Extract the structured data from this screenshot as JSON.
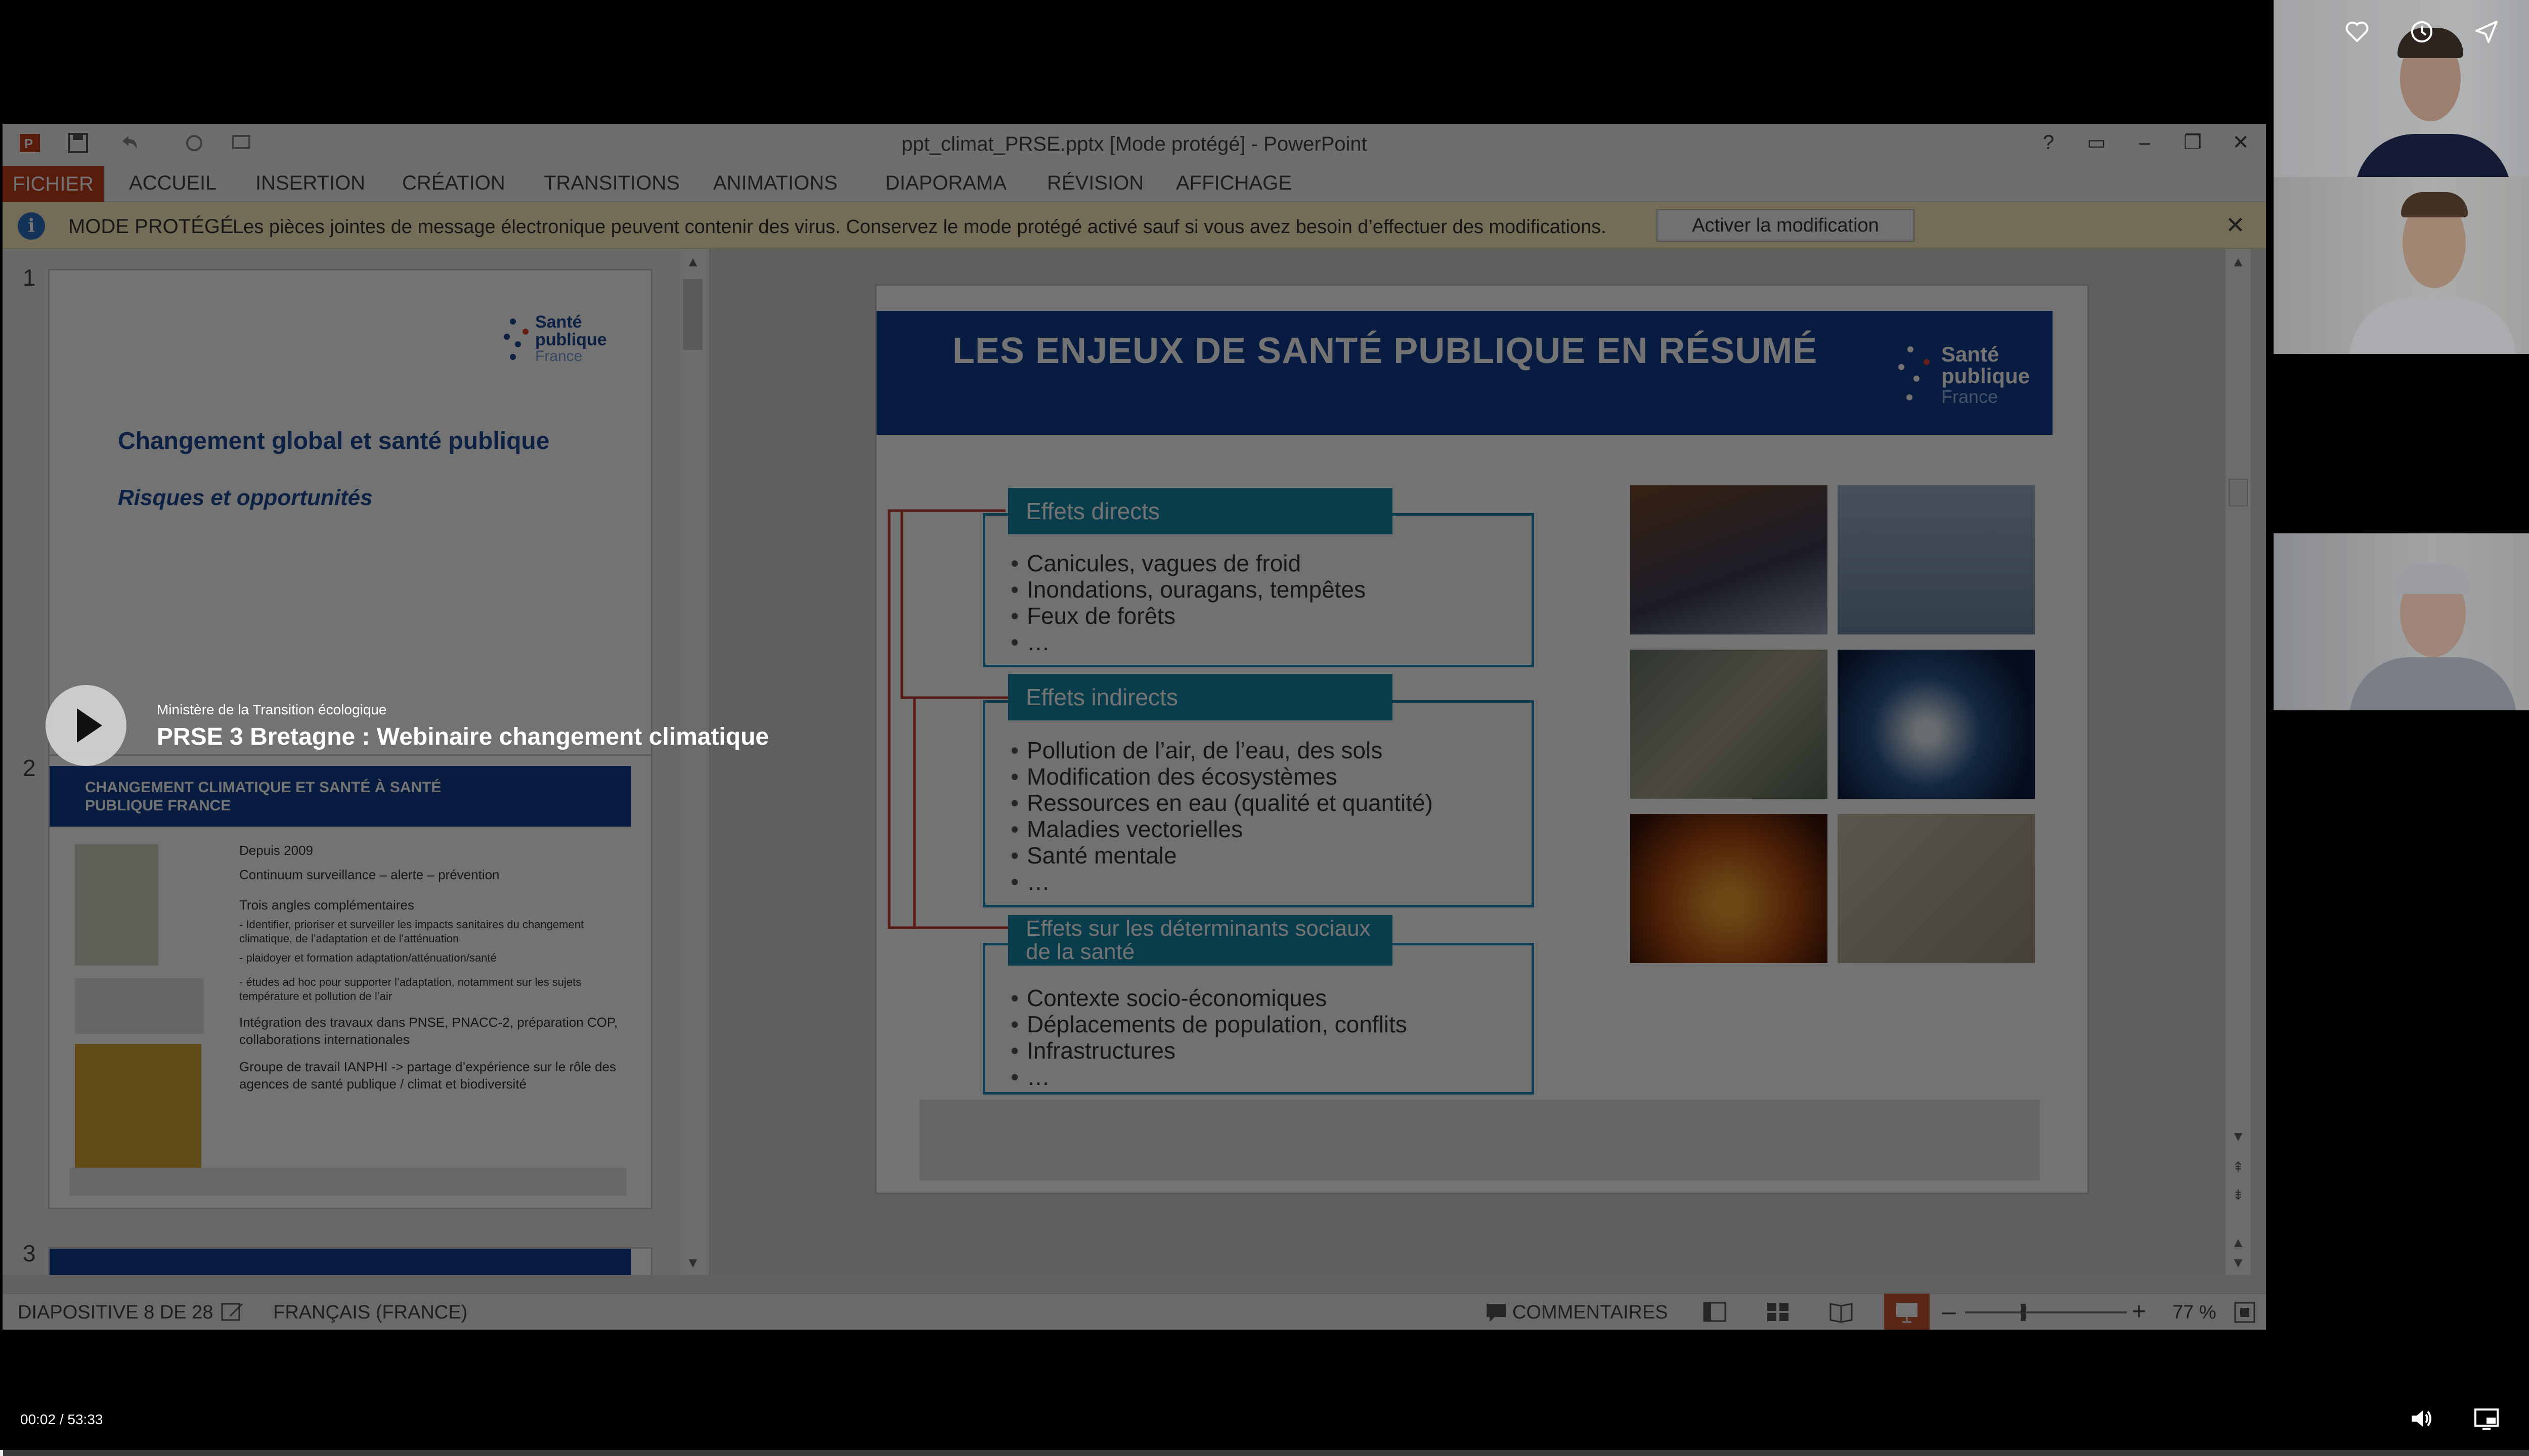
{
  "video": {
    "channel": "Ministère de la Transition écologique",
    "title": "PRSE 3 Bretagne : Webinaire changement climatique",
    "time_current": "00:02",
    "time_total": "53:33",
    "time_display": "00:02 / 53:33",
    "progress_fraction": 0.0006
  },
  "ppt": {
    "window_title": "ppt_climat_PRSE.pptx [Mode protégé] - PowerPoint",
    "tabs": [
      "FICHIER",
      "ACCUEIL",
      "INSERTION",
      "CRÉATION",
      "TRANSITIONS",
      "ANIMATIONS",
      "DIAPORAMA",
      "RÉVISION",
      "AFFICHAGE"
    ],
    "protected": {
      "title": "MODE PROTÉGÉ",
      "message": "Les pièces jointes de message électronique peuvent contenir des virus. Conservez le mode protégé activé sauf si vous avez besoin d’effectuer des modifications.",
      "button": "Activer la modification"
    },
    "status": {
      "slide": "DIAPOSITIVE 8 DE 28",
      "language": "FRANÇAIS (FRANCE)",
      "comments": "COMMENTAIRES",
      "zoom": "77 %"
    }
  },
  "thumbnails": {
    "slide1": {
      "num": "1",
      "title": "Changement global et santé publique",
      "subtitle": "Risques et opportunités"
    },
    "slide2": {
      "num": "2",
      "title": "CHANGEMENT CLIMATIQUE ET SANTÉ À SANTÉ PUBLIQUE FRANCE",
      "bullets": [
        "Depuis 2009",
        "Continuum surveillance – alerte – prévention",
        "Trois angles complémentaires",
        "- Identifier, prioriser et surveiller les impacts sanitaires du changement climatique, de l’adaptation et de l’atténuation",
        "- plaidoyer et formation adaptation/atténuation/santé",
        "- études ad hoc pour supporter l’adaptation, notamment sur les sujets température et pollution de l’air",
        "Intégration des travaux dans PNSE, PNACC-2, préparation COP, collaborations internationales",
        "Groupe de travail IANPHI -> partage d’expérience sur le rôle des agences de santé publique / climat et biodiversité"
      ]
    },
    "slide3": {
      "num": "3"
    }
  },
  "logo": {
    "line1": "Santé",
    "line2": "publique",
    "line3": "France"
  },
  "slide": {
    "title": "LES ENJEUX DE SANTÉ PUBLIQUE EN RÉSUMÉ",
    "boxes": [
      {
        "label": "Effets directs",
        "items": [
          "Canicules, vagues de froid",
          "Inondations, ouragans, tempêtes",
          "Feux de forêts",
          "…"
        ]
      },
      {
        "label": "Effets indirects",
        "items": [
          "Pollution de l’air, de l’eau, des sols",
          "Modification des écosystèmes",
          "Ressources en eau (qualité et quantité)",
          "Maladies vectorielles",
          "Santé mentale",
          "…"
        ]
      },
      {
        "label": "Effets sur les déterminants sociaux de la santé",
        "items": [
          "Contexte socio-économiques",
          "Déplacements de population, conflits",
          "Infrastructures",
          "…"
        ]
      }
    ]
  },
  "colors": {
    "ppt_accent": "#c43e1c",
    "banner": "#123e91",
    "box_accent": "#1887a8"
  }
}
